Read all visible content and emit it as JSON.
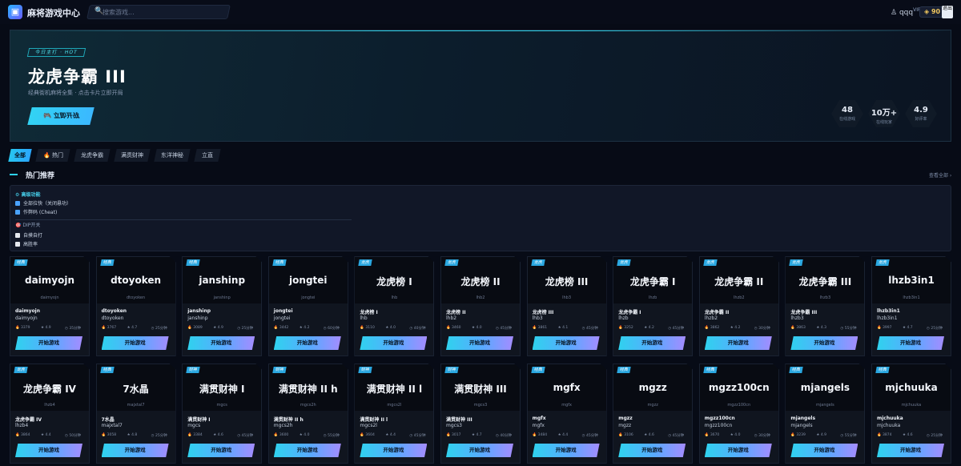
{
  "topbar": {
    "logo_text": "麻将游戏中心",
    "search_placeholder": "搜索游戏...",
    "username": "qqq",
    "vip_label": "VIP",
    "coins": "90",
    "avatar_label": "退出"
  },
  "hero": {
    "tag": "今日主打 · HOT",
    "title": "龙虎争霸 III",
    "subtitle": "经典街机麻将全集 · 点击卡片立即开局",
    "cta": "立即开战",
    "stats": [
      {
        "value": "48",
        "label": "在线游戏"
      },
      {
        "value": "10万+",
        "label": "在线玩家"
      },
      {
        "value": "4.9",
        "label": "好评率"
      }
    ]
  },
  "tabs": [
    {
      "label": "全部"
    },
    {
      "label": "🔥 热门"
    },
    {
      "label": "龙虎争霸"
    },
    {
      "label": "满贯财神"
    },
    {
      "label": "东洋神秘"
    },
    {
      "label": "立直"
    }
  ],
  "section": {
    "title": "热门推荐",
    "view_all": "查看全部 ›"
  },
  "advanced": {
    "title": "⚙ 高级功能",
    "options": [
      {
        "label": "全部拉快（关闭悬功）",
        "checked": true
      },
      {
        "label": "作弊码 (Cheat)",
        "checked": true
      }
    ],
    "dip_title": "🎯 DIP开关",
    "dip_options": [
      {
        "label": "自摸自打",
        "checked": false
      },
      {
        "label": "高胜率",
        "checked": false
      }
    ]
  },
  "play_label": "开始游戏",
  "cards_row1": [
    {
      "badge": "经典",
      "big": "daimyojn",
      "small": "daimyojn",
      "name": "daimyojn",
      "code": "daimyojn",
      "hot": "3379",
      "rating": "4.9",
      "time": "35分钟"
    },
    {
      "badge": "经典",
      "big": "dtoyoken",
      "small": "dtoyoken",
      "name": "dtoyoken",
      "code": "dtoyoken",
      "hot": "3767",
      "rating": "4.7",
      "time": "25分钟"
    },
    {
      "badge": "经典",
      "big": "janshinp",
      "small": "janshinp",
      "name": "janshinp",
      "code": "janshinp",
      "hot": "3089",
      "rating": "4.9",
      "time": "25分钟"
    },
    {
      "badge": "经典",
      "big": "jongtei",
      "small": "jongtei",
      "name": "jongtei",
      "code": "jongtei",
      "hot": "3442",
      "rating": "4.2",
      "time": "60分钟"
    },
    {
      "badge": "龙虎",
      "big": "龙虎榜 I",
      "small": "lhb",
      "name": "龙虎榜 I",
      "code": "lhb",
      "hot": "3110",
      "rating": "4.0",
      "time": "40分钟"
    },
    {
      "badge": "龙虎",
      "big": "龙虎榜 II",
      "small": "lhb2",
      "name": "龙虎榜 II",
      "code": "lhb2",
      "hot": "3460",
      "rating": "4.0",
      "time": "45分钟"
    },
    {
      "badge": "龙虎",
      "big": "龙虎榜 III",
      "small": "lhb3",
      "name": "龙虎榜 III",
      "code": "lhb3",
      "hot": "3861",
      "rating": "4.1",
      "time": "45分钟"
    },
    {
      "badge": "龙虎",
      "big": "龙虎争霸 I",
      "small": "lhzb",
      "name": "龙虎争霸 I",
      "code": "lhzb",
      "hot": "3252",
      "rating": "4.2",
      "time": "45分钟"
    },
    {
      "badge": "龙虎",
      "big": "龙虎争霸 II",
      "small": "lhzb2",
      "name": "龙虎争霸 II",
      "code": "lhzb2",
      "hot": "3862",
      "rating": "4.2",
      "time": "30分钟"
    },
    {
      "badge": "龙虎",
      "big": "龙虎争霸 III",
      "small": "lhzb3",
      "name": "龙虎争霸 III",
      "code": "lhzb3",
      "hot": "3863",
      "rating": "4.3",
      "time": "55分钟"
    },
    {
      "badge": "龙虎",
      "big": "lhzb3in1",
      "small": "lhzb3in1",
      "name": "lhzb3in1",
      "code": "lhzb3in1",
      "hot": "3997",
      "rating": "4.7",
      "time": "25分钟"
    }
  ],
  "cards_row2": [
    {
      "badge": "龙虎",
      "big": "龙虎争霸 IV",
      "small": "lhzb4",
      "name": "龙虎争霸 IV",
      "code": "lhzb4",
      "hot": "3864",
      "rating": "4.4",
      "time": "50分钟"
    },
    {
      "badge": "经典",
      "big": "7水晶",
      "small": "majxtal7",
      "name": "7水晶",
      "code": "majxtal7",
      "hot": "3058",
      "rating": "4.8",
      "time": "25分钟"
    },
    {
      "badge": "财神",
      "big": "满贯财神 I",
      "small": "mgcs",
      "name": "满贯财神 I",
      "code": "mgcs",
      "hot": "3384",
      "rating": "4.6",
      "time": "45分钟"
    },
    {
      "badge": "财神",
      "big": "满贯财神 II h",
      "small": "mgcs2h",
      "name": "满贯财神 II h",
      "code": "mgcs2h",
      "hot": "3600",
      "rating": "4.0",
      "time": "55分钟"
    },
    {
      "badge": "财神",
      "big": "满贯财神 II l",
      "small": "mgcs2l",
      "name": "满贯财神 II l",
      "code": "mgcs2l",
      "hot": "3604",
      "rating": "4.4",
      "time": "45分钟"
    },
    {
      "badge": "财神",
      "big": "满贯财神 III",
      "small": "mgcs3",
      "name": "满贯财神 III",
      "code": "mgcs3",
      "hot": "3017",
      "rating": "4.7",
      "time": "40分钟"
    },
    {
      "badge": "经典",
      "big": "mgfx",
      "small": "mgfx",
      "name": "mgfx",
      "code": "mgfx",
      "hot": "3484",
      "rating": "4.4",
      "time": "45分钟"
    },
    {
      "badge": "经典",
      "big": "mgzz",
      "small": "mgzz",
      "name": "mgzz",
      "code": "mgzz",
      "hot": "3106",
      "rating": "4.6",
      "time": "45分钟"
    },
    {
      "badge": "经典",
      "big": "mgzz100cn",
      "small": "mgzz100cn",
      "name": "mgzz100cn",
      "code": "mgzz100cn",
      "hot": "3670",
      "rating": "4.0",
      "time": "30分钟"
    },
    {
      "badge": "经典",
      "big": "mjangels",
      "small": "mjangels",
      "name": "mjangels",
      "code": "mjangels",
      "hot": "3239",
      "rating": "4.9",
      "time": "55分钟"
    },
    {
      "badge": "经典",
      "big": "mjchuuka",
      "small": "mjchuuka",
      "name": "mjchuuka",
      "code": "mjchuuka",
      "hot": "3874",
      "rating": "4.6",
      "time": "25分钟"
    }
  ]
}
